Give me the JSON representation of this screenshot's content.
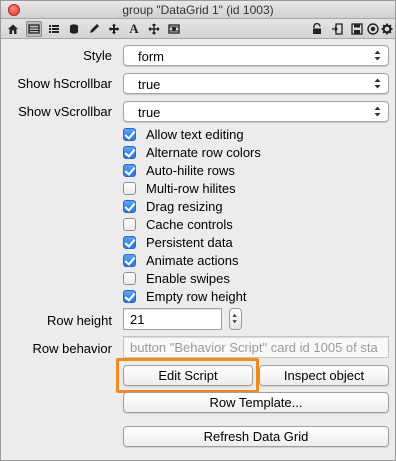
{
  "window": {
    "title": "group \"DataGrid 1\" (id 1003)"
  },
  "toolbar": {
    "icons": [
      "house-icon",
      "grid-view-icon",
      "list-icon",
      "database-icon",
      "pencil-icon",
      "move-icon",
      "text-icon",
      "pan-icon",
      "media-icon",
      "lock-icon",
      "exit-icon",
      "save-icon",
      "target-icon",
      "gear-icon"
    ],
    "text_glyph": "A"
  },
  "style": {
    "label": "Style",
    "value": "form"
  },
  "hscroll": {
    "label": "Show hScrollbar",
    "value": "true"
  },
  "vscroll": {
    "label": "Show vScrollbar",
    "value": "true"
  },
  "checkboxes": [
    {
      "label": "Allow text editing",
      "checked": true
    },
    {
      "label": "Alternate row colors",
      "checked": true
    },
    {
      "label": "Auto-hilite rows",
      "checked": true
    },
    {
      "label": "Multi-row hilites",
      "checked": false
    },
    {
      "label": "Drag resizing",
      "checked": true
    },
    {
      "label": "Cache controls",
      "checked": false
    },
    {
      "label": "Persistent data",
      "checked": true
    },
    {
      "label": "Animate actions",
      "checked": true
    },
    {
      "label": "Enable swipes",
      "checked": false
    },
    {
      "label": "Empty row height",
      "checked": true
    }
  ],
  "row_height": {
    "label": "Row height",
    "value": "21"
  },
  "row_behavior": {
    "label": "Row behavior",
    "value": "button \"Behavior Script\" card  id 1005 of sta"
  },
  "buttons": {
    "edit_script": "Edit Script",
    "inspect_object": "Inspect object",
    "row_template": "Row Template...",
    "refresh": "Refresh Data Grid"
  },
  "colors": {
    "highlight": "#f28a1e",
    "checkbox_on": "#2a78dd"
  }
}
